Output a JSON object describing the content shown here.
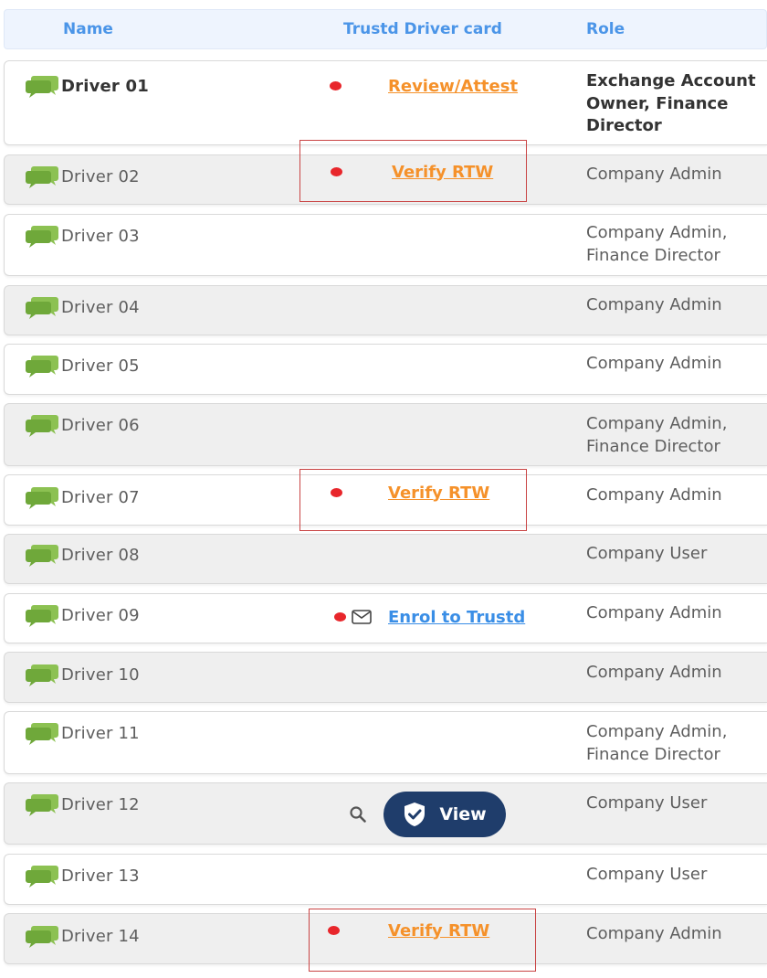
{
  "table": {
    "headers": {
      "name": "Name",
      "card": "Trustd Driver card",
      "role": "Role"
    },
    "rows": [
      {
        "name": "Driver 01",
        "action": "Review/Attest",
        "role_line1": "Exchange Account",
        "role_line2": "Owner, Finance",
        "role_line3": "Director"
      },
      {
        "name": "Driver 02",
        "action": "Verify RTW",
        "role_line1": "Company Admin"
      },
      {
        "name": "Driver 03",
        "role_line1": "Company Admin,",
        "role_line2": "Finance Director"
      },
      {
        "name": "Driver 04",
        "role_line1": "Company Admin"
      },
      {
        "name": "Driver 05",
        "role_line1": "Company Admin"
      },
      {
        "name": "Driver 06",
        "role_line1": "Company Admin,",
        "role_line2": "Finance Director"
      },
      {
        "name": "Driver 07",
        "action": "Verify RTW",
        "role_line1": "Company Admin"
      },
      {
        "name": "Driver 08",
        "role_line1": "Company User"
      },
      {
        "name": "Driver 09",
        "action": "Enrol to Trustd",
        "role_line1": "Company Admin"
      },
      {
        "name": "Driver 10",
        "role_line1": "Company Admin"
      },
      {
        "name": "Driver 11",
        "role_line1": "Company Admin,",
        "role_line2": "Finance Director"
      },
      {
        "name": "Driver 12",
        "action": "View",
        "role_line1": "Company User"
      },
      {
        "name": "Driver 13",
        "role_line1": "Company User"
      },
      {
        "name": "Driver 14",
        "action": "Verify RTW",
        "role_line1": "Company Admin"
      }
    ]
  },
  "colors": {
    "header_text": "#4b95e8",
    "link_orange": "#f5912a",
    "link_blue": "#3a8ee6",
    "status_dot": "#e8262b",
    "view_button": "#1f3d6b",
    "chat_icon": "#7ab648",
    "highlight_border": "#c94444"
  },
  "icons": {
    "name_icon": "chat-bubbles-icon",
    "status_icon": "red-dot-icon",
    "mail_icon": "envelope-icon",
    "search_icon": "magnifier-icon",
    "verified_icon": "shield-check-icon"
  }
}
